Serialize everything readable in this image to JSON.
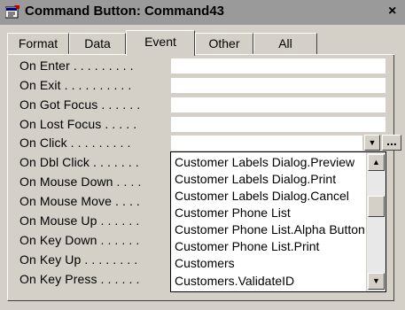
{
  "window": {
    "title": "Command Button: Command43",
    "close_glyph": "×",
    "icon": "property-sheet-icon"
  },
  "tabs": [
    "Format",
    "Data",
    "Event",
    "Other",
    "All"
  ],
  "active_tab": "Event",
  "properties": [
    {
      "label": "On Enter . . . . . . . . .",
      "value": ""
    },
    {
      "label": "On Exit . . . . . . . . . .",
      "value": ""
    },
    {
      "label": "On Got Focus . . . . . .",
      "value": ""
    },
    {
      "label": "On Lost Focus . . . . .",
      "value": ""
    },
    {
      "label": "On Click . . . . . . . . .",
      "value": ""
    },
    {
      "label": "On Dbl Click . . . . . . .",
      "value": ""
    },
    {
      "label": "On Mouse Down . . . .",
      "value": ""
    },
    {
      "label": "On Mouse Move . . . .",
      "value": ""
    },
    {
      "label": "On Mouse Up . . . . . .",
      "value": ""
    },
    {
      "label": "On Key Down . . . . . .",
      "value": ""
    },
    {
      "label": "On Key Up . . . . . . . .",
      "value": ""
    },
    {
      "label": "On Key Press . . . . . .",
      "value": ""
    }
  ],
  "combo": {
    "arrow_glyph": "▼",
    "build_label": "..."
  },
  "dropdown_items": [
    "Customer Labels Dialog.Preview",
    "Customer Labels Dialog.Print",
    "Customer Labels Dialog.Cancel",
    "Customer Phone List",
    "Customer Phone List.Alpha Buttons",
    "Customer Phone List.Print",
    "Customers",
    "Customers.ValidateID"
  ],
  "scrollbar": {
    "up_glyph": "▲",
    "down_glyph": "▼"
  }
}
